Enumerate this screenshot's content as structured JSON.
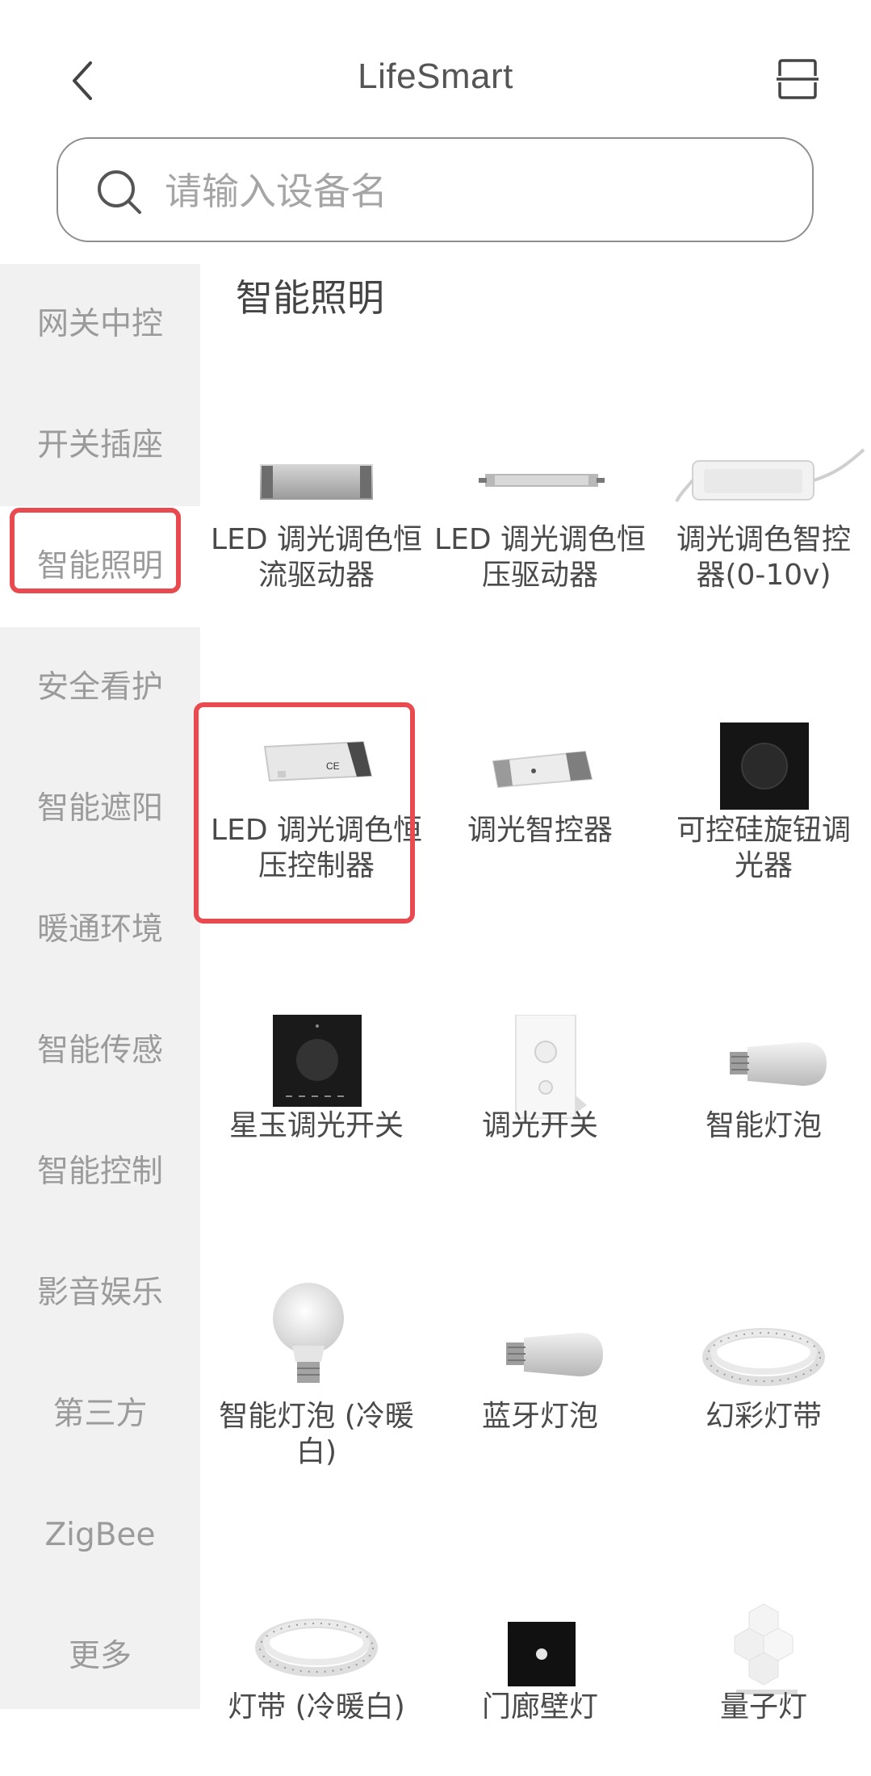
{
  "header": {
    "title": "LifeSmart",
    "back_icon": "chevron-left-icon",
    "scan_icon": "scan-icon"
  },
  "search": {
    "placeholder": "请输入设备名",
    "value": ""
  },
  "sidebar": {
    "items": [
      {
        "label": "网关中控"
      },
      {
        "label": "开关插座"
      },
      {
        "label": "智能照明",
        "active": true
      },
      {
        "label": "安全看护"
      },
      {
        "label": "智能遮阳"
      },
      {
        "label": "暖通环境"
      },
      {
        "label": "智能传感"
      },
      {
        "label": "智能控制"
      },
      {
        "label": "影音娱乐"
      },
      {
        "label": "第三方"
      },
      {
        "label": "ZigBee"
      },
      {
        "label": "更多"
      }
    ]
  },
  "main": {
    "section_title": "智能照明",
    "products": [
      {
        "name": "LED 调光调色恒流驱动器",
        "icon": "led-driver-gray-icon"
      },
      {
        "name": "LED 调光调色恒压驱动器",
        "icon": "slim-driver-icon"
      },
      {
        "name": "调光调色智控器(0-10v)",
        "icon": "white-controller-icon"
      },
      {
        "name": "LED 调光调色恒压控制器",
        "icon": "ce-controller-icon",
        "highlighted": true
      },
      {
        "name": "调光智控器",
        "icon": "dimmer-controller-icon"
      },
      {
        "name": "可控硅旋钮调光器",
        "icon": "black-knob-panel-icon"
      },
      {
        "name": "星玉调光开关",
        "icon": "star-jade-dimmer-icon"
      },
      {
        "name": "调光开关",
        "icon": "white-dimmer-switch-icon"
      },
      {
        "name": "智能灯泡",
        "icon": "smart-bulb-icon"
      },
      {
        "name": "智能灯泡 (冷暖白)",
        "icon": "white-bulb-icon"
      },
      {
        "name": "蓝牙灯泡",
        "icon": "bluetooth-bulb-icon"
      },
      {
        "name": "幻彩灯带",
        "icon": "rgb-strip-icon"
      },
      {
        "name": "灯带 (冷暖白)",
        "icon": "strip-white-icon"
      },
      {
        "name": "门廊壁灯",
        "icon": "porch-light-icon"
      },
      {
        "name": "量子灯",
        "icon": "quantum-light-icon"
      }
    ]
  },
  "colors": {
    "highlight": "#e84a4f",
    "sidebar_bg": "#f1f1f1",
    "sidebar_text": "#9b9b9b"
  }
}
